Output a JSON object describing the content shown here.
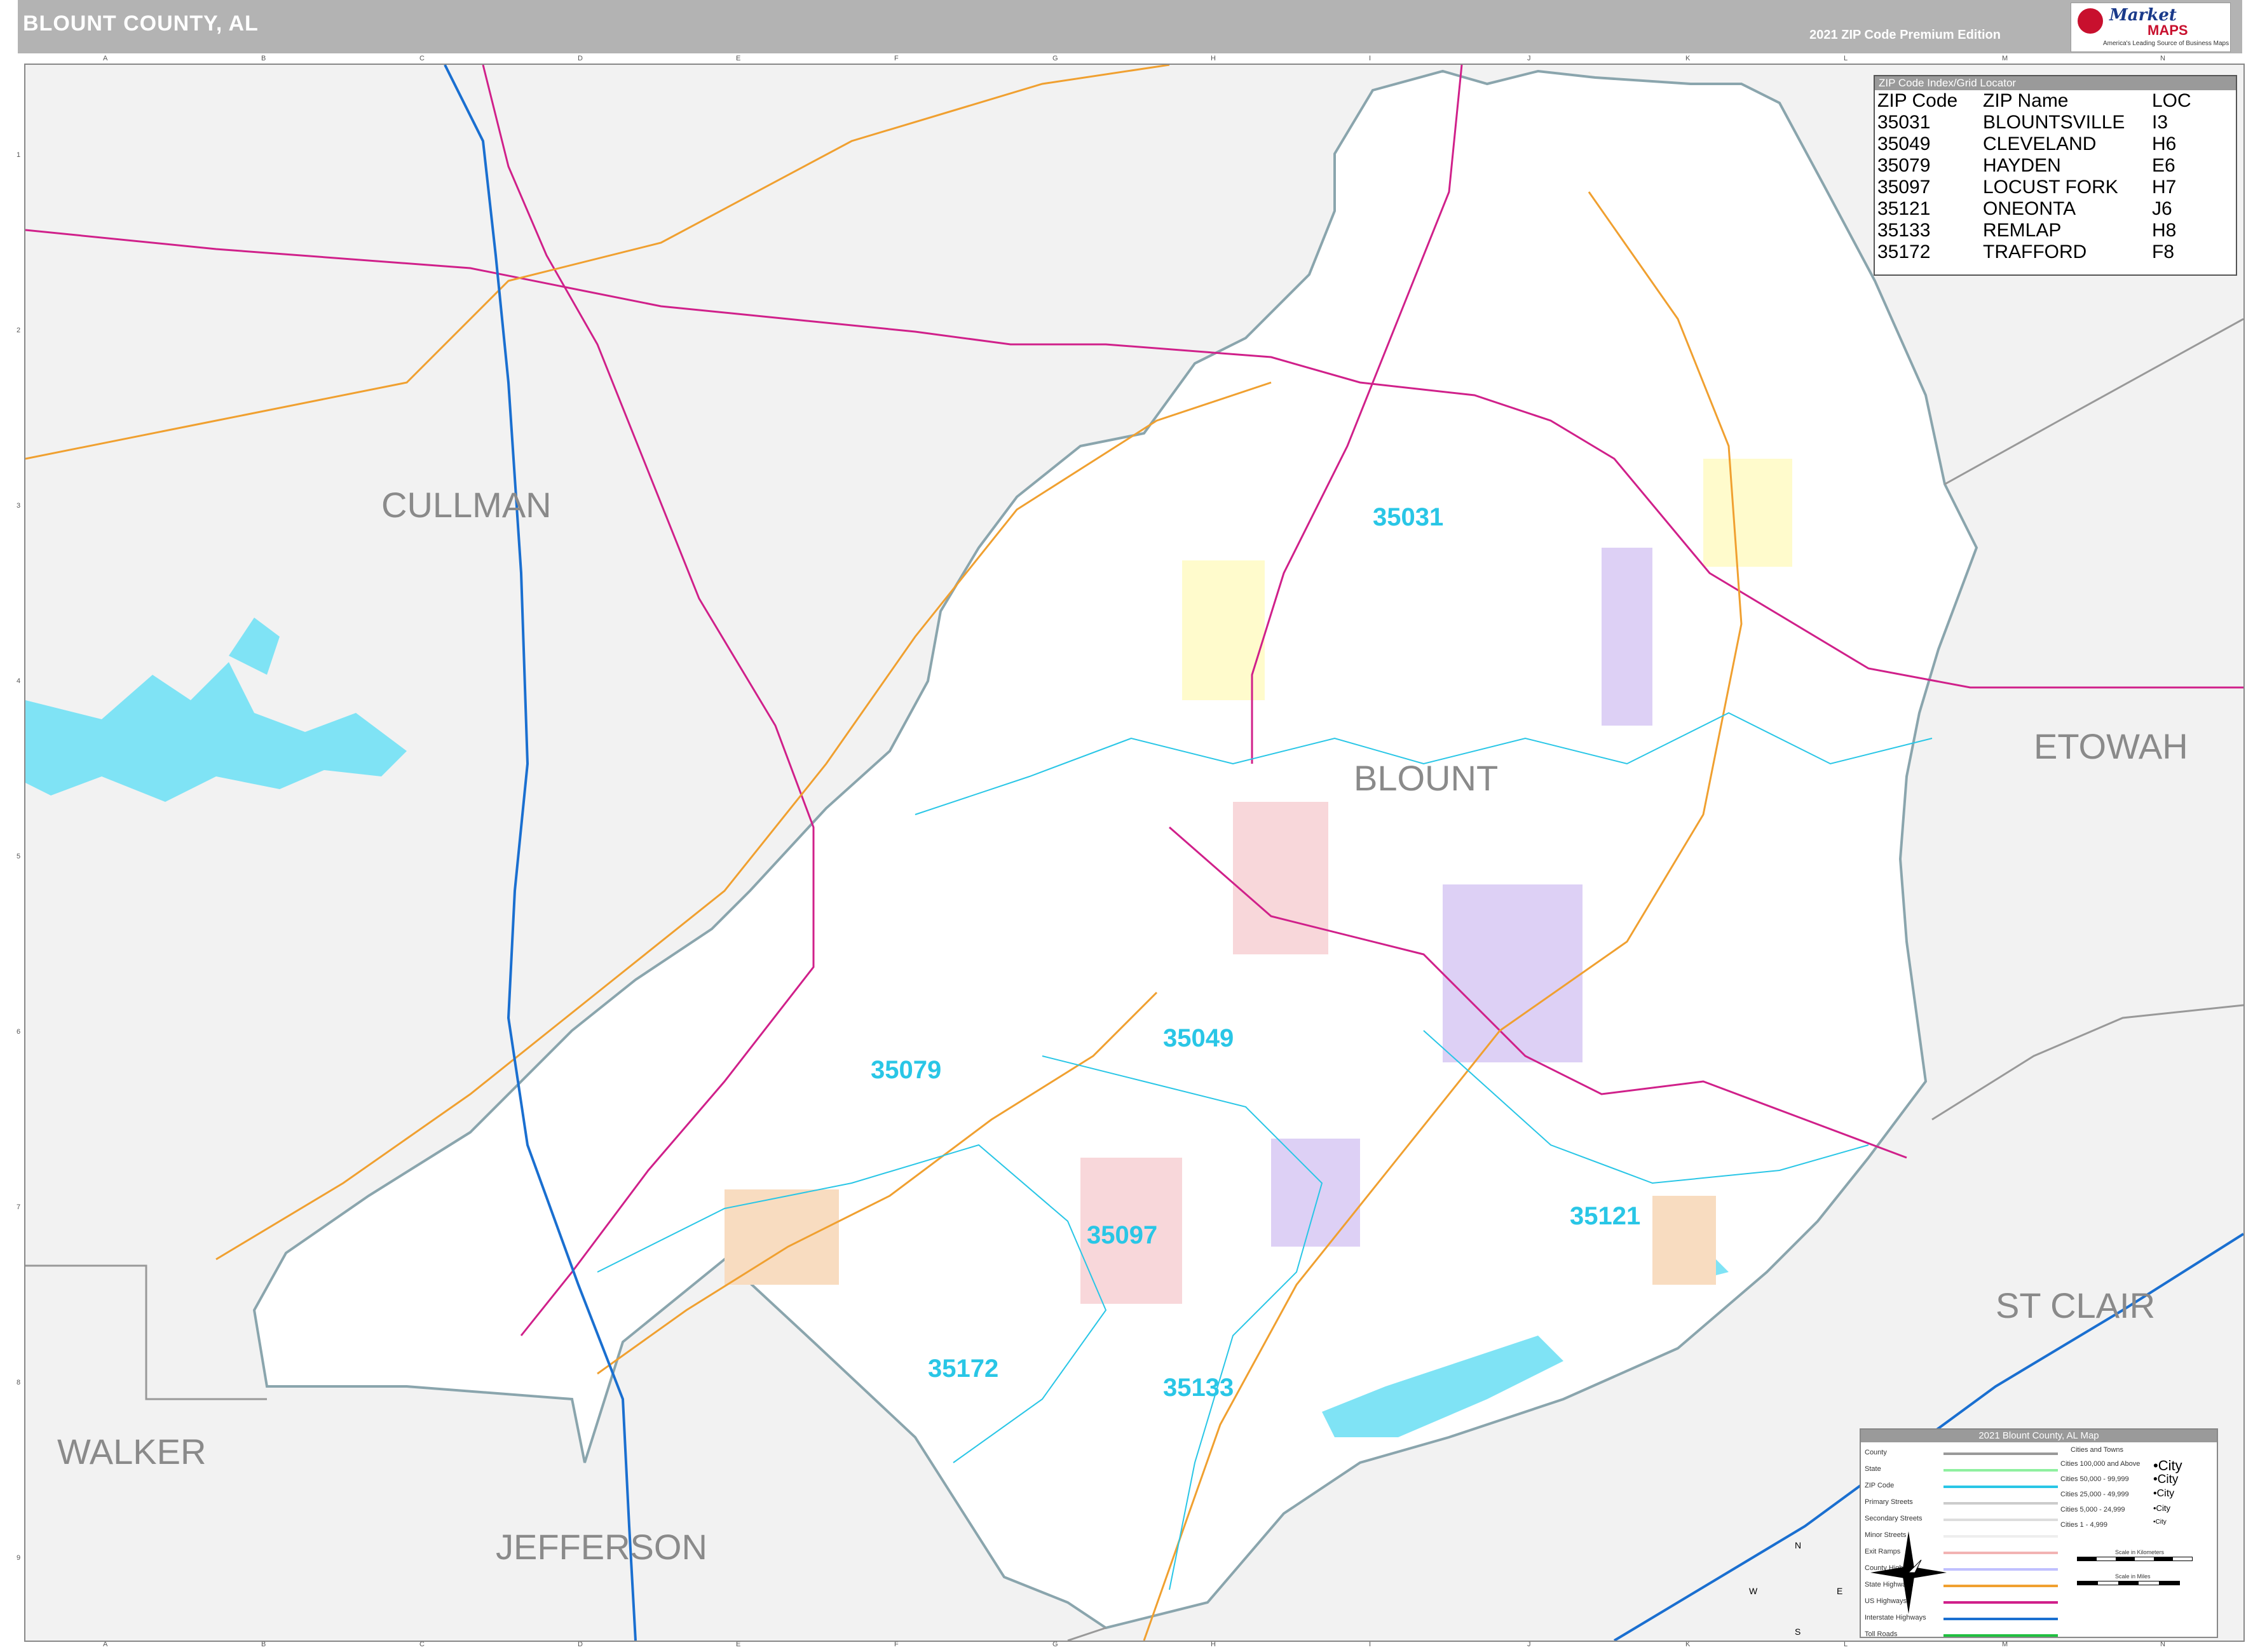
{
  "header": {
    "title": "BLOUNT COUNTY, AL",
    "edition": "2021 ZIP Code Premium Edition",
    "logo": {
      "line1": "Market",
      "line2": "MAPS",
      "tagline": "America's Leading Source of Business Maps"
    }
  },
  "grid": {
    "columns": [
      "A",
      "B",
      "C",
      "D",
      "E",
      "F",
      "G",
      "H",
      "I",
      "J",
      "K",
      "L",
      "M",
      "N"
    ],
    "rows": [
      "1",
      "2",
      "3",
      "4",
      "5",
      "6",
      "7",
      "8",
      "9"
    ]
  },
  "counties": {
    "cullman": "CULLMAN",
    "blount": "BLOUNT",
    "etowah": "ETOWAH",
    "st_clair": "ST CLAIR",
    "walker": "WALKER",
    "jefferson": "JEFFERSON"
  },
  "zip_labels": {
    "z35031": "35031",
    "z35049": "35049",
    "z35079": "35079",
    "z35121": "35121",
    "z35097": "35097",
    "z35172": "35172",
    "z35133": "35133"
  },
  "zip_index": {
    "title": "ZIP Code Index/Grid Locator",
    "headers": [
      "ZIP Code",
      "ZIP Name",
      "LOC"
    ],
    "rows": [
      [
        "35031",
        "BLOUNTSVILLE",
        "I3"
      ],
      [
        "35049",
        "CLEVELAND",
        "H6"
      ],
      [
        "35079",
        "HAYDEN",
        "E6"
      ],
      [
        "35097",
        "LOCUST FORK",
        "H7"
      ],
      [
        "35121",
        "ONEONTA",
        "J6"
      ],
      [
        "35133",
        "REMLAP",
        "H8"
      ],
      [
        "35172",
        "TRAFFORD",
        "F8"
      ]
    ]
  },
  "legend": {
    "title": "2021 Blount County, AL Map",
    "items": [
      {
        "label": "County",
        "color": "#999999"
      },
      {
        "label": "State",
        "color": "#8ff0a0"
      },
      {
        "label": "ZIP Code",
        "color": "#29c6e6"
      },
      {
        "label": "Primary Streets",
        "color": "#cccccc"
      },
      {
        "label": "Secondary Streets",
        "color": "#dddddd"
      },
      {
        "label": "Minor Streets",
        "color": "#eeeeee"
      },
      {
        "label": "Exit Ramps",
        "color": "#f2b3b3"
      },
      {
        "label": "County Highways",
        "color": "#c0c0ff"
      },
      {
        "label": "State Highways",
        "color": "#f0a030"
      },
      {
        "label": "US Highways",
        "color": "#d0208a"
      },
      {
        "label": "Interstate Highways",
        "color": "#1a6fd0"
      },
      {
        "label": "Toll Roads",
        "color": "#20c040"
      }
    ],
    "cities_title": "Cities and Towns",
    "cities": [
      {
        "label": "Cities 100,000 and Above",
        "sample": "•City"
      },
      {
        "label": "Cities 50,000 - 99,999",
        "sample": "•City"
      },
      {
        "label": "Cities 25,000 - 49,999",
        "sample": "•City"
      },
      {
        "label": "Cities 5,000 - 24,999",
        "sample": "•City"
      },
      {
        "label": "Cities 1 - 4,999",
        "sample": "•City"
      }
    ],
    "scale_km": "Scale in Kilometers",
    "scale_mi": "Scale in Miles",
    "compass": {
      "n": "N",
      "s": "S",
      "e": "E",
      "w": "W"
    }
  },
  "colors": {
    "water": "#7fe3f5",
    "county_fill": "#ffffff",
    "outside": "#f2f2f2",
    "boundary": "#8aa5ad",
    "us_highway": "#d0208a",
    "state_highway": "#f0a030",
    "interstate": "#1a6fd0",
    "zip_line": "#29c6e6"
  }
}
